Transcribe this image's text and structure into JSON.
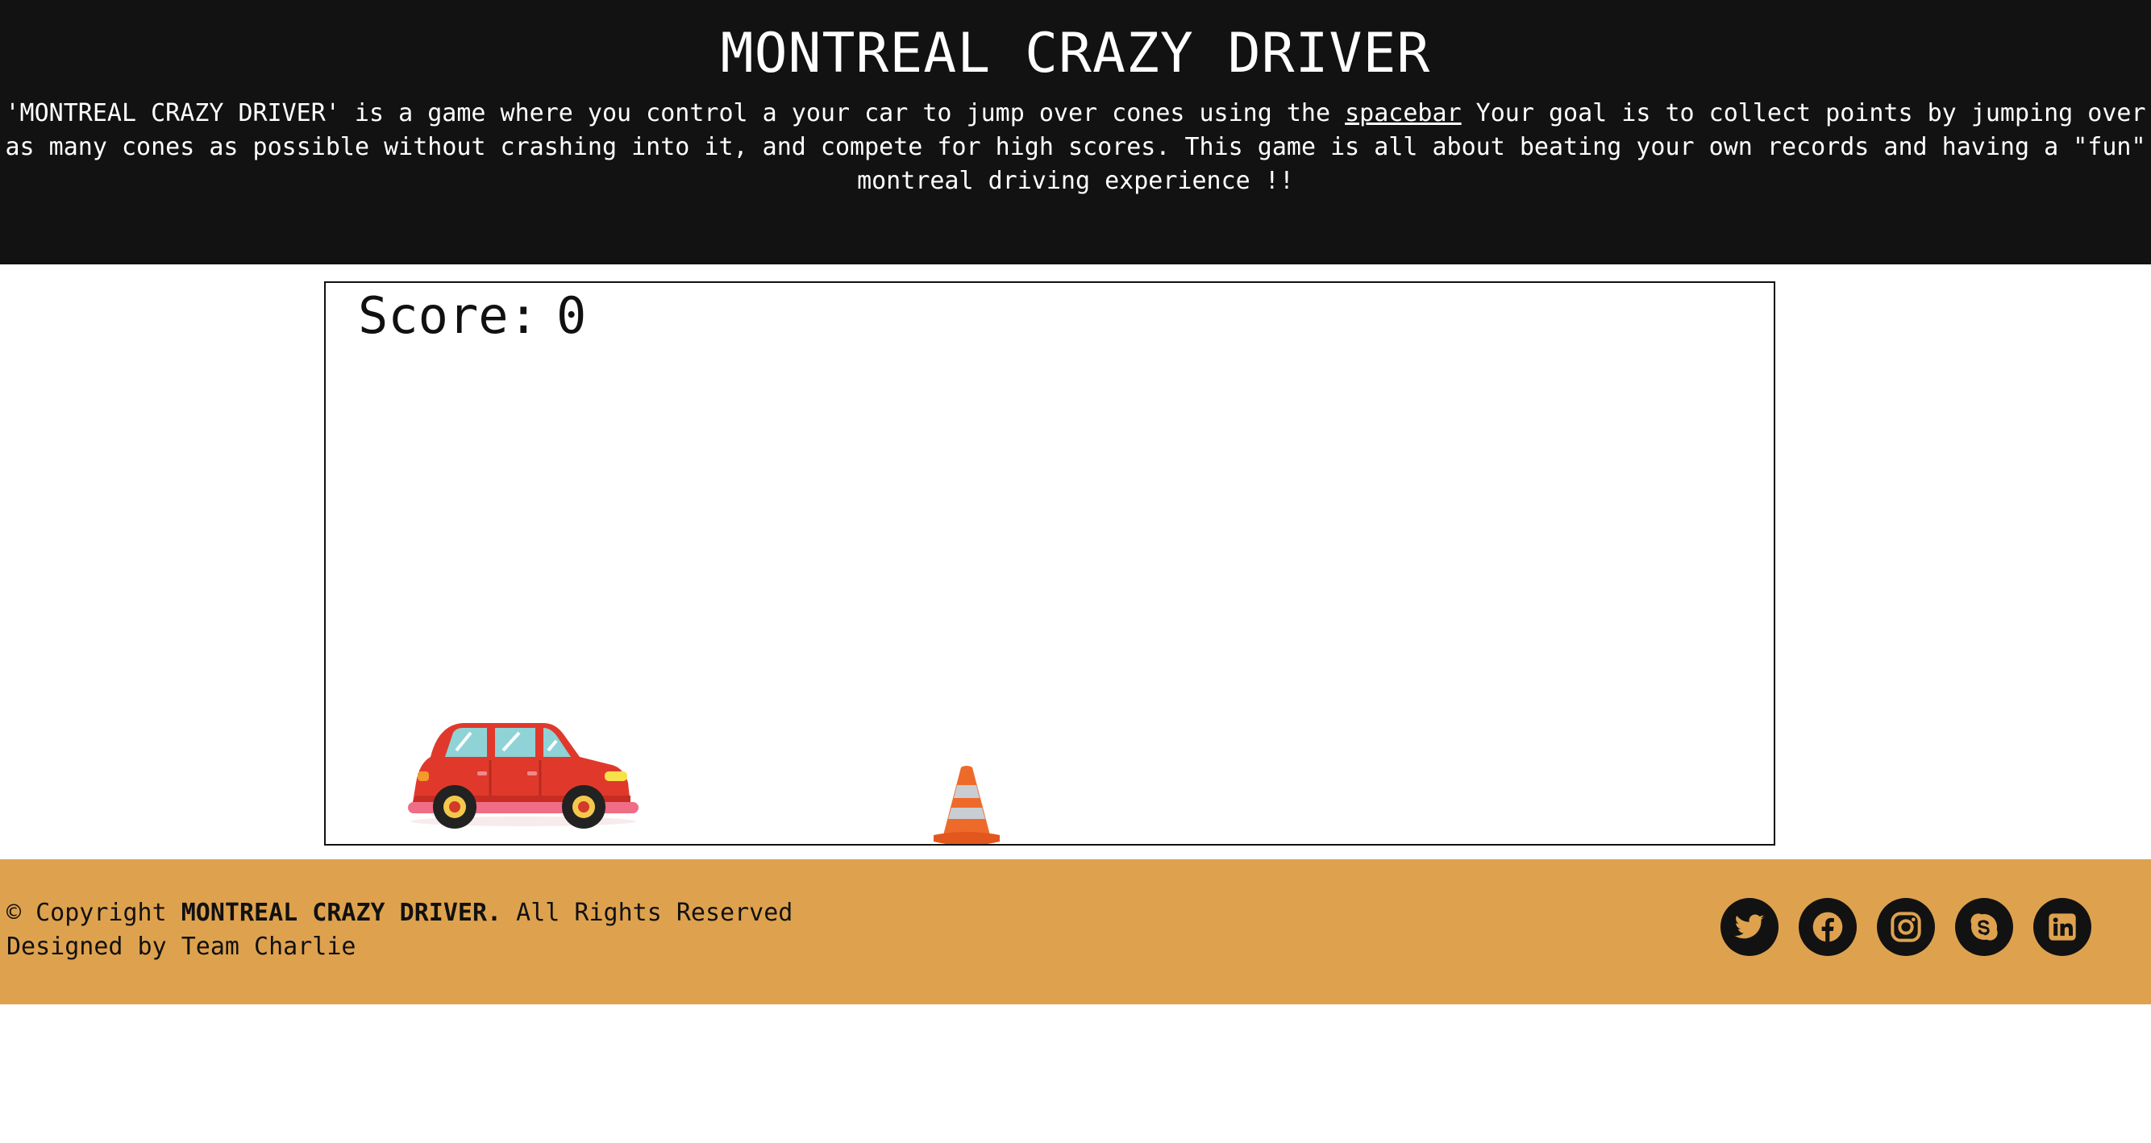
{
  "header": {
    "title": "MONTREAL CRAZY DRIVER",
    "desc_before": "'MONTREAL CRAZY DRIVER' is a game where you control a your car to jump over cones using the ",
    "desc_key": "spacebar",
    "desc_after": " Your goal is to collect points by jumping over as many cones as possible without crashing into it, and compete for high scores. This game is all about beating your own records and having a \"fun\" montreal driving experience !!"
  },
  "game": {
    "score_label": "Score:",
    "score_value": "0",
    "sprites": [
      "car-sprite",
      "traffic-cone-sprite"
    ]
  },
  "footer": {
    "copyright_prefix": "© Copyright ",
    "copyright_brand": "MONTREAL CRAZY DRIVER.",
    "copyright_suffix": " All Rights Reserved",
    "designed_by": "Designed by Team Charlie",
    "socials": [
      "twitter-icon",
      "facebook-icon",
      "instagram-icon",
      "skype-icon",
      "linkedin-icon"
    ]
  },
  "colors": {
    "header_bg": "#121212",
    "footer_bg": "#dea24e",
    "icon_accent": "#dea24e",
    "car_body": "#e0392b",
    "cone": "#ee6a2a"
  }
}
